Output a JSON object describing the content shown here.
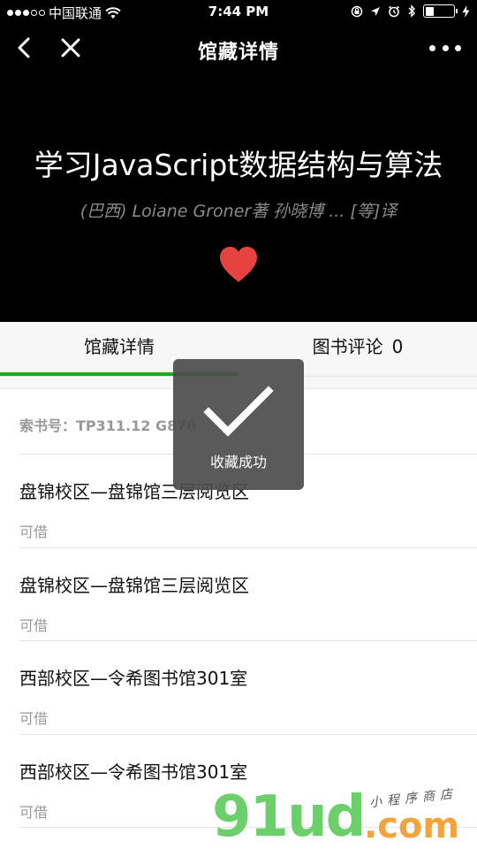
{
  "status_bar": {
    "carrier": "中国联通",
    "time": "7:44 PM"
  },
  "nav": {
    "title": "馆藏详情"
  },
  "book": {
    "title": "学习JavaScript数据结构与算法",
    "author": "(巴西) Loiane Groner著 孙晓博 ... [等]译"
  },
  "tabs": [
    {
      "label": "馆藏详情",
      "active": true
    },
    {
      "label": "图书评论",
      "count": "0",
      "active": false
    }
  ],
  "call_number": "索书号：TP311.12 G876",
  "copies": [
    {
      "location": "盘锦校区—盘锦馆三层阅览区",
      "status": "可借"
    },
    {
      "location": "盘锦校区—盘锦馆三层阅览区",
      "status": "可借"
    },
    {
      "location": "西部校区—令希图书馆301室",
      "status": "可借"
    },
    {
      "location": "西部校区—令希图书馆301室",
      "status": "可借"
    }
  ],
  "toast": {
    "text": "收藏成功",
    "icon": "check-icon"
  },
  "watermark": {
    "main": "91ud",
    "suffix": ".com",
    "tag": "小程序商店"
  },
  "colors": {
    "accent": "#1aad19",
    "heart": "#e64340",
    "header_bg": "#000000",
    "toast_bg": "#4c4c4c"
  }
}
